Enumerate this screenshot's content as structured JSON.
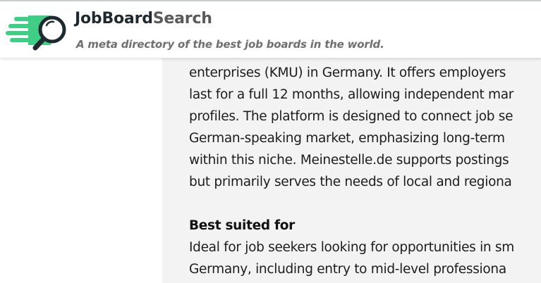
{
  "header": {
    "brand_part1": "JobBoard",
    "brand_part2": "Search",
    "tagline": "A meta directory of the best job boards in the world."
  },
  "colors": {
    "logo_green": "#3ecf84",
    "logo_dark": "#1f2a30",
    "content_bg": "#f3f3f3"
  },
  "description": {
    "lines": [
      "enterprises (KMU) in Germany. It offers employers",
      "last for a full 12 months, allowing independent mar",
      "profiles. The platform is designed to connect job se",
      "German-speaking market, emphasizing long-term",
      "within this niche. Meinestelle.de supports postings",
      "but primarily serves the needs of local and regiona"
    ]
  },
  "best_suited": {
    "heading": "Best suited for",
    "lines": [
      "Ideal for job seekers looking for opportunities in sm",
      "Germany, including entry to mid-level professiona"
    ]
  }
}
